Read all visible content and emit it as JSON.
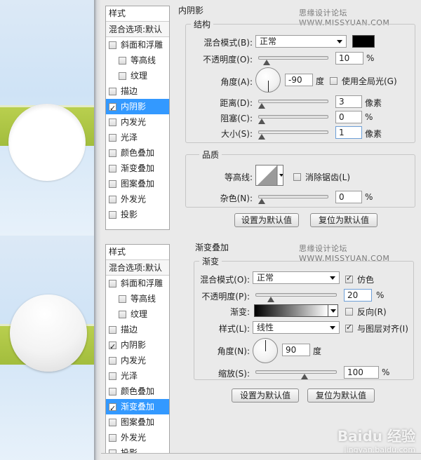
{
  "watermark": "思缘设计论坛 WWW.MISSYUAN.COM",
  "style_list": {
    "header": "样式",
    "blend_options": "混合选项:默认",
    "items": [
      {
        "label": "斜面和浮雕",
        "sub": false
      },
      {
        "label": "等高线",
        "sub": true
      },
      {
        "label": "纹理",
        "sub": true
      },
      {
        "label": "描边",
        "sub": false
      },
      {
        "label": "内阴影",
        "sub": false
      },
      {
        "label": "内发光",
        "sub": false
      },
      {
        "label": "光泽",
        "sub": false
      },
      {
        "label": "颜色叠加",
        "sub": false
      },
      {
        "label": "渐变叠加",
        "sub": false
      },
      {
        "label": "图案叠加",
        "sub": false
      },
      {
        "label": "外发光",
        "sub": false
      },
      {
        "label": "投影",
        "sub": false
      }
    ]
  },
  "top_panel": {
    "section_title": "内阴影",
    "structure_legend": "结构",
    "blend_mode_label": "混合模式(B):",
    "blend_mode_value": "正常",
    "swatch_color": "#000000",
    "opacity_label": "不透明度(O):",
    "opacity_value": "10",
    "opacity_unit": "%",
    "angle_label": "角度(A):",
    "angle_value": "-90",
    "angle_unit": "度",
    "global_light_label": "使用全局光(G)",
    "distance_label": "距离(D):",
    "distance_value": "3",
    "distance_unit": "像素",
    "choke_label": "阻塞(C):",
    "choke_value": "0",
    "choke_unit": "%",
    "size_label": "大小(S):",
    "size_value": "1",
    "size_unit": "像素",
    "quality_legend": "品质",
    "contour_label": "等高线:",
    "anti_alias_label": "消除锯齿(L)",
    "noise_label": "杂色(N):",
    "noise_value": "0",
    "noise_unit": "%",
    "make_default": "设置为默认值",
    "reset_default": "复位为默认值",
    "selected_item": 4,
    "checked_items": [
      4
    ]
  },
  "bottom_panel": {
    "section_title": "渐变叠加",
    "gradient_legend": "渐变",
    "blend_mode_label": "混合模式(O):",
    "blend_mode_value": "正常",
    "dither_label": "仿色",
    "opacity_label": "不透明度(P):",
    "opacity_value": "20",
    "opacity_unit": "%",
    "gradient_label": "渐变:",
    "reverse_label": "反向(R)",
    "style_label": "样式(L):",
    "style_value": "线性",
    "align_label": "与图层对齐(I)",
    "angle_label": "角度(N):",
    "angle_value": "90",
    "angle_unit": "度",
    "scale_label": "缩放(S):",
    "scale_value": "100",
    "scale_unit": "%",
    "make_default": "设置为默认值",
    "reset_default": "复位为默认值",
    "selected_item": 8,
    "checked_items": [
      4,
      8
    ]
  },
  "baidu_logo": {
    "text": "Baidu 经验",
    "sub": "jingyan.baidu.com"
  }
}
